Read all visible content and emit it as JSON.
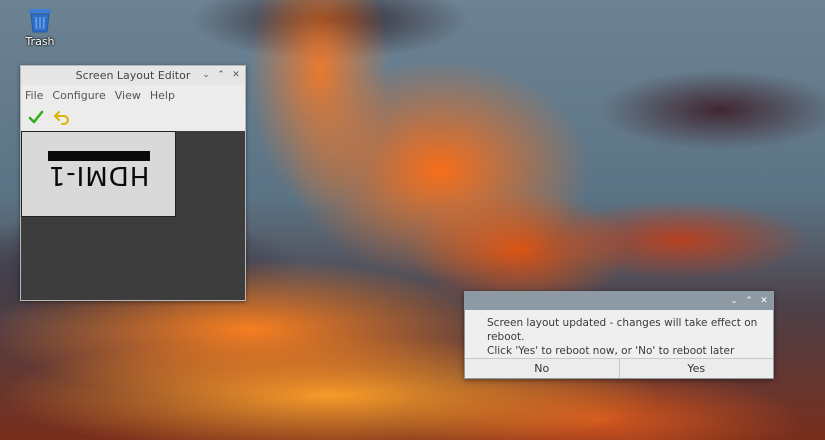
{
  "desktop": {
    "trash_label": "Trash"
  },
  "editor": {
    "title": "Screen Layout Editor",
    "menu": [
      "File",
      "Configure",
      "View",
      "Help"
    ],
    "toolbar": {
      "apply_icon": "check-icon",
      "revert_icon": "undo-icon"
    },
    "monitor_label": "HDMI-1",
    "monitor_rotation": "inverted"
  },
  "dialog": {
    "message_line1": "Screen layout updated - changes will take effect on reboot.",
    "message_line2": "Click 'Yes' to reboot now, or 'No' to reboot later",
    "no_label": "No",
    "yes_label": "Yes"
  },
  "window_controls": {
    "minimize": "⌄",
    "maximize": "⌃",
    "close": "✕"
  },
  "colors": {
    "dialog_titlebar": "#8d99a3",
    "canvas_bg": "#3d3d3d",
    "apply_green": "#2fae1a",
    "revert_yellow": "#d9b400"
  }
}
